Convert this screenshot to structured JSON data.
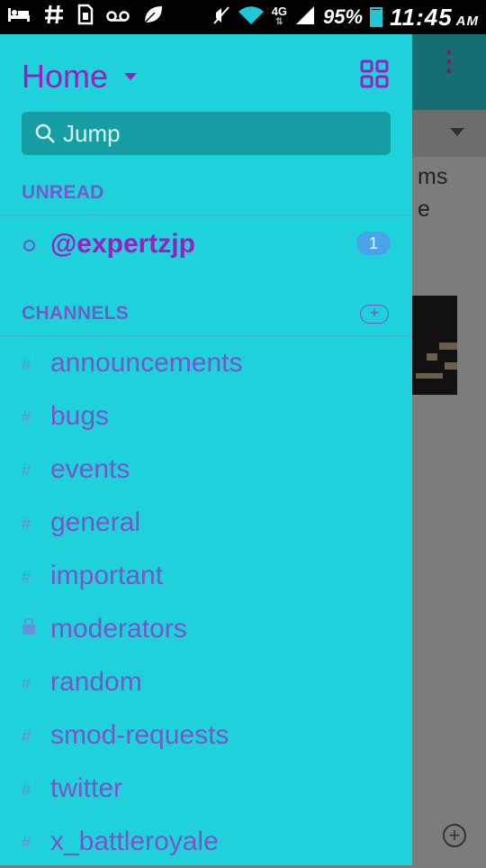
{
  "status_bar": {
    "icons": [
      "bed-icon",
      "hashtag-icon",
      "sim-icon",
      "voicemail-icon",
      "leaf-icon",
      "mute-icon",
      "wifi-icon",
      "4g-icon",
      "signal-icon"
    ],
    "network": "4G",
    "battery": "95%",
    "time": "11:45",
    "ampm": "AM"
  },
  "drawer": {
    "title": "Home",
    "search_placeholder": "Jump",
    "unread_label": "UNREAD",
    "channels_label": "CHANNELS",
    "add_channel_label": "+",
    "unread": [
      {
        "name": "@expertzjp",
        "badge": "1"
      }
    ],
    "channels": [
      {
        "name": "announcements",
        "private": false
      },
      {
        "name": "bugs",
        "private": false
      },
      {
        "name": "events",
        "private": false
      },
      {
        "name": "general",
        "private": false
      },
      {
        "name": "important",
        "private": false
      },
      {
        "name": "moderators",
        "private": true
      },
      {
        "name": "random",
        "private": false
      },
      {
        "name": "smod-requests",
        "private": false
      },
      {
        "name": "twitter",
        "private": false
      },
      {
        "name": "x_battleroyale",
        "private": false
      }
    ],
    "hash": "#"
  },
  "background": {
    "text_line1": "ms",
    "text_line2": "e",
    "kebab": "⋮"
  },
  "colors": {
    "drawer_bg": "#1fd1db",
    "accent": "#9a1fbe",
    "channel_text": "#7b55c8",
    "badge": "#4aa3e8"
  }
}
